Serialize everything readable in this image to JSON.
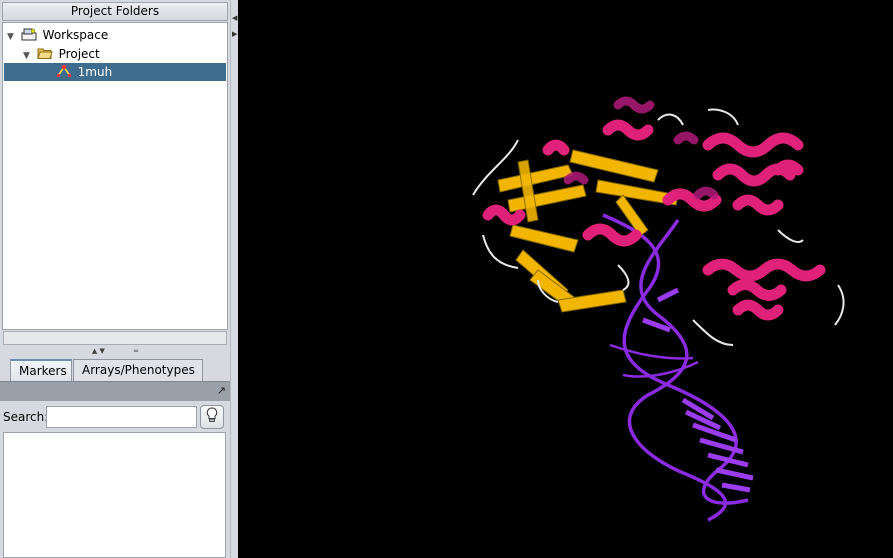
{
  "project_panel": {
    "title": "Project Folders",
    "tree": [
      {
        "label": "Workspace",
        "icon": "workspace-icon",
        "expanded": true
      },
      {
        "label": "Project",
        "icon": "folder-open-icon",
        "expanded": true
      },
      {
        "label": "1muh",
        "icon": "structure-icon",
        "selected": true
      }
    ]
  },
  "tabs": [
    {
      "label": "Markers",
      "active": true
    },
    {
      "label": "Arrays/Phenotypes",
      "active": false
    }
  ],
  "markers": {
    "search_label": "Search:",
    "search_value": ""
  },
  "colors": {
    "selection": "#3e6c8e",
    "viewer_background": "#000000",
    "helix": "#e0217a",
    "sheet": "#f2b600",
    "dna": "#8a2be2",
    "coil": "#e8e8e8"
  }
}
